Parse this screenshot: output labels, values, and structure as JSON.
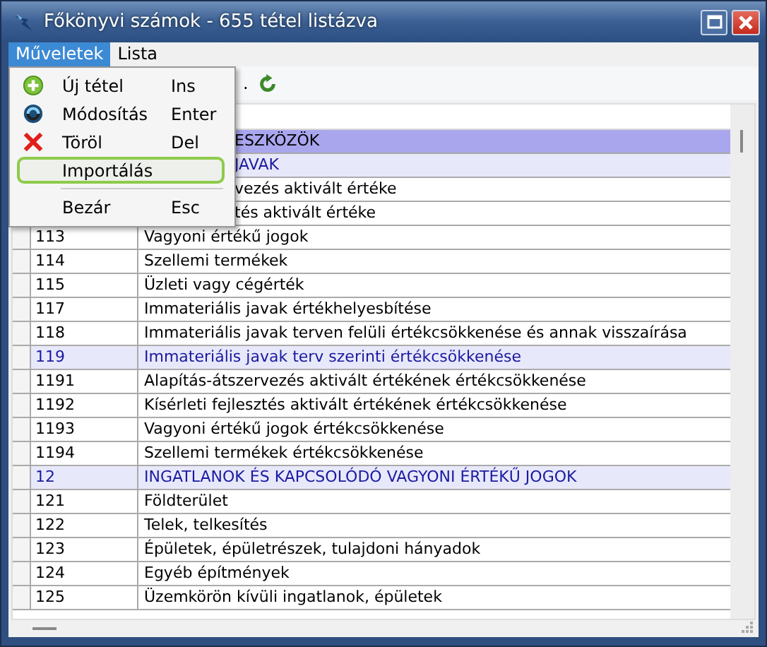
{
  "window": {
    "title": "Főkönyvi számok - 655 tétel listázva"
  },
  "menubar": [
    {
      "label": "Műveletek",
      "selected": true
    },
    {
      "label": "Lista",
      "selected": false
    }
  ],
  "menu": {
    "items": [
      {
        "kind": "item",
        "label": "Új tétel",
        "shortcut": "Ins",
        "highlighted": false
      },
      {
        "kind": "item",
        "label": "Módosítás",
        "shortcut": "Enter",
        "highlighted": false
      },
      {
        "kind": "item",
        "label": "Töröl",
        "shortcut": "Del",
        "highlighted": false
      },
      {
        "kind": "item",
        "label": "Importálás",
        "highlighted": true
      },
      {
        "kind": "separator"
      },
      {
        "kind": "item",
        "label": "Bezár",
        "shortcut": "Esc",
        "highlighted": false
      }
    ]
  },
  "toolbar": {
    "text": "."
  },
  "table": {
    "rows": [
      {
        "kind": "group",
        "name": "ESZKÖZÖK",
        "under_menu": true
      },
      {
        "kind": "subgroup",
        "name": "JAVAK",
        "under_menu": true
      },
      {
        "kind": "item",
        "name": "vezés aktivált értéke",
        "under_menu": true
      },
      {
        "kind": "item",
        "name": "tés aktivált értéke",
        "under_menu": true
      },
      {
        "kind": "item",
        "code": "113",
        "name": "Vagyoni értékű jogok"
      },
      {
        "kind": "item",
        "code": "114",
        "name": "Szellemi termékek"
      },
      {
        "kind": "item",
        "code": "115",
        "name": "Üzleti vagy cégérték"
      },
      {
        "kind": "item",
        "code": "117",
        "name": "Immateriális javak értékhelyesbítése"
      },
      {
        "kind": "item",
        "code": "118",
        "name": "Immateriális javak terven felüli értékcsökkenése és annak visszaírása"
      },
      {
        "kind": "subgroup",
        "code": "119",
        "name": "Immateriális javak terv szerinti értékcsökkenése"
      },
      {
        "kind": "item",
        "code": "1191",
        "name": "Alapítás-átszervezés aktivált értékének értékcsökkenése"
      },
      {
        "kind": "item",
        "code": "1192",
        "name": "Kísérleti fejlesztés aktivált értékének értékcsökkenése"
      },
      {
        "kind": "item",
        "code": "1193",
        "name": "Vagyoni értékű jogok értékcsökkenése"
      },
      {
        "kind": "item",
        "code": "1194",
        "name": "Szellemi termékek értékcsökkenése"
      },
      {
        "kind": "subgroup",
        "code": "12",
        "name": "INGATLANOK ÉS KAPCSOLÓDÓ VAGYONI ÉRTÉKŰ JOGOK"
      },
      {
        "kind": "item",
        "code": "121",
        "name": "Földterület"
      },
      {
        "kind": "item",
        "code": "122",
        "name": "Telek, telkesítés"
      },
      {
        "kind": "item",
        "code": "123",
        "name": "Épületek, épületrészek, tulajdoni hányadok"
      },
      {
        "kind": "item",
        "code": "124",
        "name": "Egyéb építmények"
      },
      {
        "kind": "item",
        "code": "125",
        "name": "Üzemkörön kívüli ingatlanok, épületek"
      }
    ]
  }
}
